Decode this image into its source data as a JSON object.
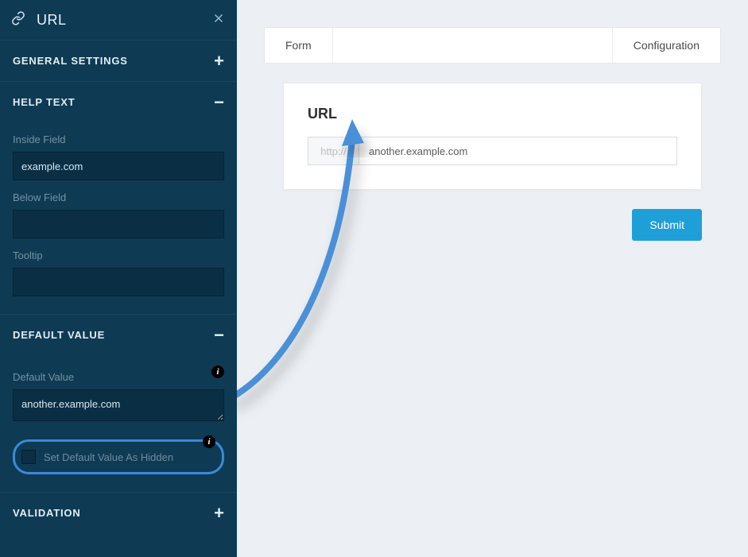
{
  "sidebar": {
    "title": "URL",
    "sections": {
      "general": {
        "title": "GENERAL SETTINGS",
        "collapsed": true
      },
      "help": {
        "title": "HELP TEXT",
        "collapsed": false,
        "inside_label": "Inside Field",
        "inside_value": "example.com",
        "below_label": "Below Field",
        "below_value": "",
        "tooltip_label": "Tooltip",
        "tooltip_value": ""
      },
      "default": {
        "title": "DEFAULT VALUE",
        "collapsed": false,
        "default_label": "Default Value",
        "default_value": "another.example.com",
        "hidden_label": "Set Default Value As Hidden",
        "hidden_checked": false
      },
      "validation": {
        "title": "VALIDATION",
        "collapsed": true
      }
    }
  },
  "tabs": {
    "form": "Form",
    "configuration": "Configuration"
  },
  "form_card": {
    "title": "URL",
    "prefix": "http://",
    "value": "another.example.com"
  },
  "buttons": {
    "submit": "Submit"
  },
  "colors": {
    "accent": "#1f9fd8",
    "annotation": "#3a8ad8",
    "sidebar_bg": "#0e3a54"
  }
}
